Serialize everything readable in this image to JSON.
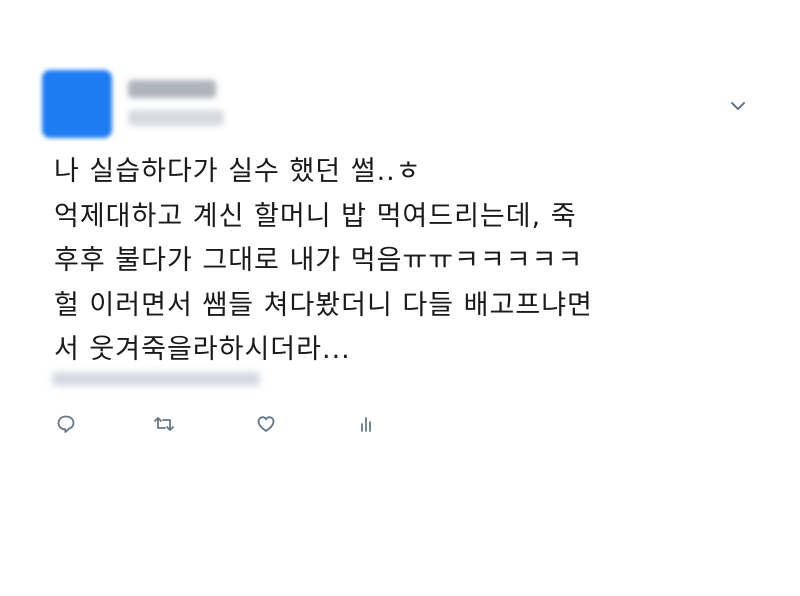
{
  "tweet": {
    "lines": [
      "나 실습하다가 실수 했던 썰..ㅎ",
      "억제대하고 계신 할머니 밥 먹여드리는데, 죽",
      "후후 불다가 그대로 내가 먹음ㅠㅠㅋㅋㅋㅋㅋ",
      "헐 이러면서 쌤들 쳐다봤더니 다들 배고프냐면",
      "서 웃겨죽을라하시더라..."
    ]
  },
  "icons": {
    "avatar": "avatar-blurred",
    "menu": "chevron-down-icon",
    "actions": [
      "reply-icon",
      "retweet-icon",
      "like-icon",
      "analytics-icon"
    ]
  },
  "colors": {
    "avatar": "#1d7cf2",
    "icon": "#657786",
    "text": "#1a1a1a"
  }
}
